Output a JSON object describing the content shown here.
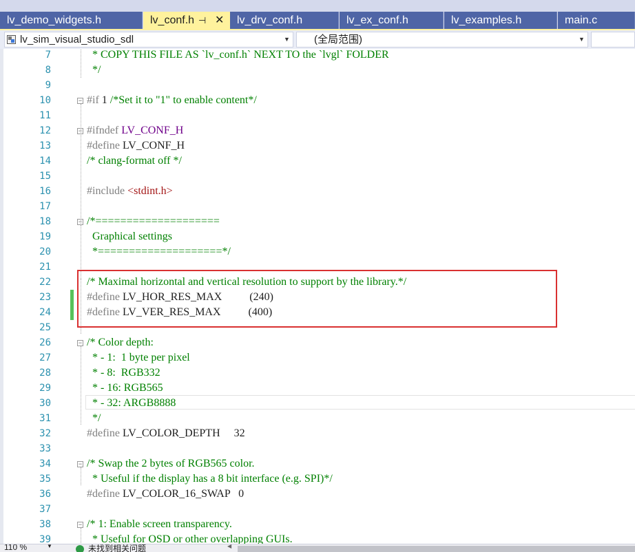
{
  "tabs": [
    {
      "label": "lv_demo_widgets.h",
      "active": false
    },
    {
      "label": "lv_conf.h",
      "active": true,
      "pin_glyph": "⊣",
      "close_glyph": "✕"
    },
    {
      "label": "lv_drv_conf.h",
      "active": false
    },
    {
      "label": "lv_ex_conf.h",
      "active": false
    },
    {
      "label": "lv_examples.h",
      "active": false
    },
    {
      "label": "main.c",
      "active": false
    }
  ],
  "navbar": {
    "project": "lv_sim_visual_studio_sdl",
    "scope": "(全局范围)"
  },
  "editor": {
    "line_numbers": [
      "7",
      "8",
      "9",
      "10",
      "11",
      "12",
      "13",
      "14",
      "15",
      "16",
      "17",
      "18",
      "19",
      "20",
      "21",
      "22",
      "23",
      "24",
      "25",
      "26",
      "27",
      "28",
      "29",
      "30",
      "31",
      "32",
      "33",
      "34",
      "35",
      "36",
      "37",
      "38",
      "39"
    ],
    "lines": [
      {
        "no": "7",
        "segs": [
          {
            "t": "* COPY THIS FILE AS `lv_conf.h` NEXT TO the `lvgl` FOLDER",
            "c": "cm"
          }
        ],
        "indent": 1
      },
      {
        "no": "8",
        "segs": [
          {
            "t": "*/",
            "c": "cm"
          }
        ],
        "indent": 1
      },
      {
        "no": "9",
        "segs": []
      },
      {
        "no": "10",
        "segs": [
          {
            "t": "#if ",
            "c": "pp"
          },
          {
            "t": "1 ",
            "c": "tx"
          },
          {
            "t": "/*Set it to \"1\" to enable content*/",
            "c": "cm"
          }
        ]
      },
      {
        "no": "11",
        "segs": []
      },
      {
        "no": "12",
        "segs": [
          {
            "t": "#ifndef ",
            "c": "pp"
          },
          {
            "t": "LV_CONF_H",
            "c": "mac"
          }
        ]
      },
      {
        "no": "13",
        "segs": [
          {
            "t": "#define ",
            "c": "pp"
          },
          {
            "t": "LV_CONF_H",
            "c": "tx"
          }
        ]
      },
      {
        "no": "14",
        "segs": [
          {
            "t": "/* clang-format off */",
            "c": "cm"
          }
        ]
      },
      {
        "no": "15",
        "segs": []
      },
      {
        "no": "16",
        "segs": [
          {
            "t": "#include ",
            "c": "pp"
          },
          {
            "t": "<stdint.h>",
            "c": "str"
          }
        ]
      },
      {
        "no": "17",
        "segs": []
      },
      {
        "no": "18",
        "segs": [
          {
            "t": "/*====================",
            "c": "cm"
          }
        ]
      },
      {
        "no": "19",
        "segs": [
          {
            "t": "Graphical settings",
            "c": "cm"
          }
        ],
        "indent": 1
      },
      {
        "no": "20",
        "segs": [
          {
            "t": "*====================*/",
            "c": "cm"
          }
        ],
        "indent": 1
      },
      {
        "no": "21",
        "segs": []
      },
      {
        "no": "22",
        "segs": [
          {
            "t": "/* Maximal horizontal and vertical resolution to support by the library.*/",
            "c": "cm"
          }
        ]
      },
      {
        "no": "23",
        "segs": [
          {
            "t": "#define ",
            "c": "pp"
          },
          {
            "t": "LV_HOR_RES_MAX          (240)",
            "c": "tx"
          }
        ]
      },
      {
        "no": "24",
        "segs": [
          {
            "t": "#define ",
            "c": "pp"
          },
          {
            "t": "LV_VER_RES_MAX          (400)",
            "c": "tx"
          }
        ]
      },
      {
        "no": "25",
        "segs": []
      },
      {
        "no": "26",
        "segs": [
          {
            "t": "/* Color depth:",
            "c": "cm"
          }
        ]
      },
      {
        "no": "27",
        "segs": [
          {
            "t": "* - 1:  1 byte per pixel",
            "c": "cm"
          }
        ],
        "indent": 1
      },
      {
        "no": "28",
        "segs": [
          {
            "t": "* - 8:  RGB332",
            "c": "cm"
          }
        ],
        "indent": 1
      },
      {
        "no": "29",
        "segs": [
          {
            "t": "* - 16: RGB565",
            "c": "cm"
          }
        ],
        "indent": 1
      },
      {
        "no": "30",
        "segs": [
          {
            "t": "* - 32: ARGB8888",
            "c": "cm"
          }
        ],
        "indent": 1
      },
      {
        "no": "31",
        "segs": [
          {
            "t": "*/",
            "c": "cm"
          }
        ],
        "indent": 1
      },
      {
        "no": "32",
        "segs": [
          {
            "t": "#define ",
            "c": "pp"
          },
          {
            "t": "LV_COLOR_DEPTH     32",
            "c": "tx"
          }
        ]
      },
      {
        "no": "33",
        "segs": []
      },
      {
        "no": "34",
        "segs": [
          {
            "t": "/* Swap the 2 bytes of RGB565 color.",
            "c": "cm"
          }
        ]
      },
      {
        "no": "35",
        "segs": [
          {
            "t": "* Useful if the display has a 8 bit interface (e.g. SPI)*/",
            "c": "cm"
          }
        ],
        "indent": 1
      },
      {
        "no": "36",
        "segs": [
          {
            "t": "#define ",
            "c": "pp"
          },
          {
            "t": "LV_COLOR_16_SWAP   0",
            "c": "tx"
          }
        ]
      },
      {
        "no": "37",
        "segs": []
      },
      {
        "no": "38",
        "segs": [
          {
            "t": "/* 1: Enable screen transparency.",
            "c": "cm"
          }
        ]
      },
      {
        "no": "39",
        "segs": [
          {
            "t": "* Useful for OSD or other overlapping GUIs.",
            "c": "cm"
          }
        ],
        "indent": 1
      }
    ]
  },
  "statusbar": {
    "zoom": "110 %",
    "issues": "未找到相关问题"
  },
  "colors": {
    "tab_bg": "#4f65a6",
    "tab_active_bg": "#fff29d",
    "comment": "#008000",
    "preprocessor": "#808080",
    "macro": "#6f008a",
    "string": "#a31515",
    "line_number": "#2b91af",
    "highlight_box": "#d93030",
    "change_marker": "#58c15a"
  }
}
